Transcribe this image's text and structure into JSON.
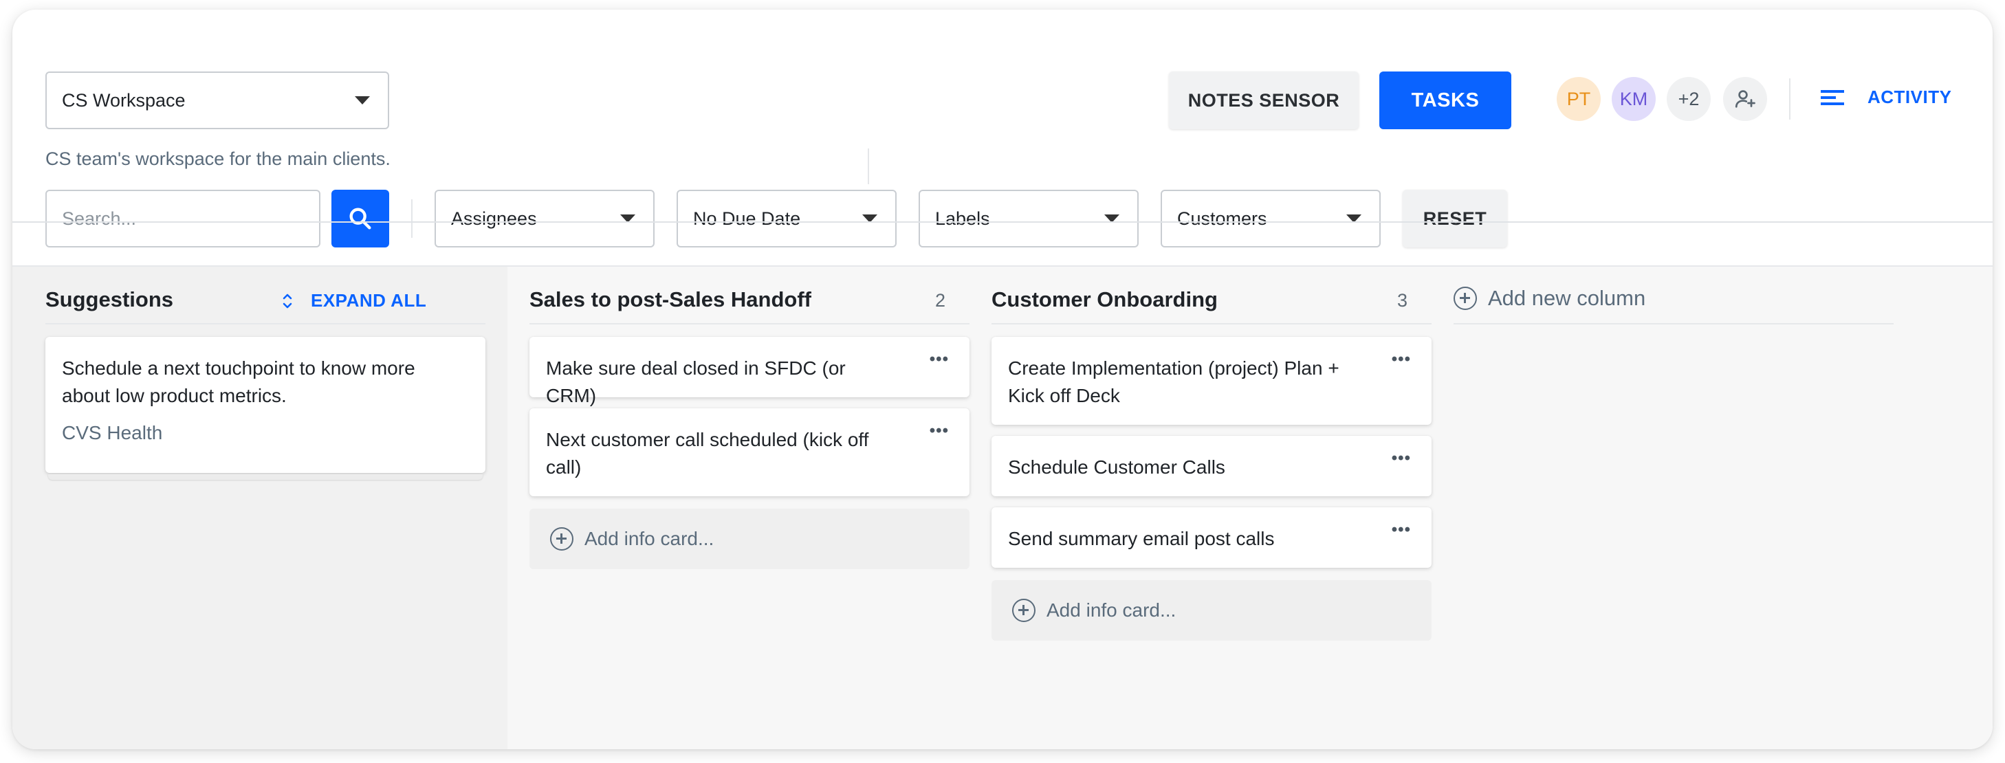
{
  "workspace": {
    "selected": "CS Workspace",
    "description": "CS team's workspace for the main clients."
  },
  "header": {
    "notes_sensor_label": "NOTES SENSOR",
    "tasks_label": "TASKS",
    "avatars": [
      {
        "initials": "PT",
        "bg": "#fde9cf",
        "fg": "#e8901a"
      },
      {
        "initials": "KM",
        "bg": "#e1dcfb",
        "fg": "#6a55d6"
      }
    ],
    "more_members": "+2",
    "activity_label": "ACTIVITY"
  },
  "filters": {
    "search_placeholder": "Search...",
    "assignees": "Assignees",
    "due_date": "No Due Date",
    "labels": "Labels",
    "customers": "Customers",
    "reset": "RESET"
  },
  "suggestions": {
    "title": "Suggestions",
    "expand_all": "EXPAND ALL",
    "card_text": "Schedule a next touchpoint to know more about low product metrics.",
    "card_customer": "CVS Health"
  },
  "columns": [
    {
      "title": "Sales to post-Sales Handoff",
      "count": "2",
      "cards": [
        "Make sure deal closed in SFDC (or CRM)",
        "Next customer call scheduled (kick off call)"
      ],
      "add_label": "Add info card..."
    },
    {
      "title": "Customer Onboarding",
      "count": "3",
      "cards": [
        "Create Implementation (project)  Plan + Kick off Deck",
        "Schedule Customer Calls",
        "Send summary email post calls"
      ],
      "add_label": "Add info card..."
    }
  ],
  "add_column_label": "Add new column",
  "colors": {
    "primary": "#0a63ff",
    "muted_text": "#5a6b7b"
  }
}
